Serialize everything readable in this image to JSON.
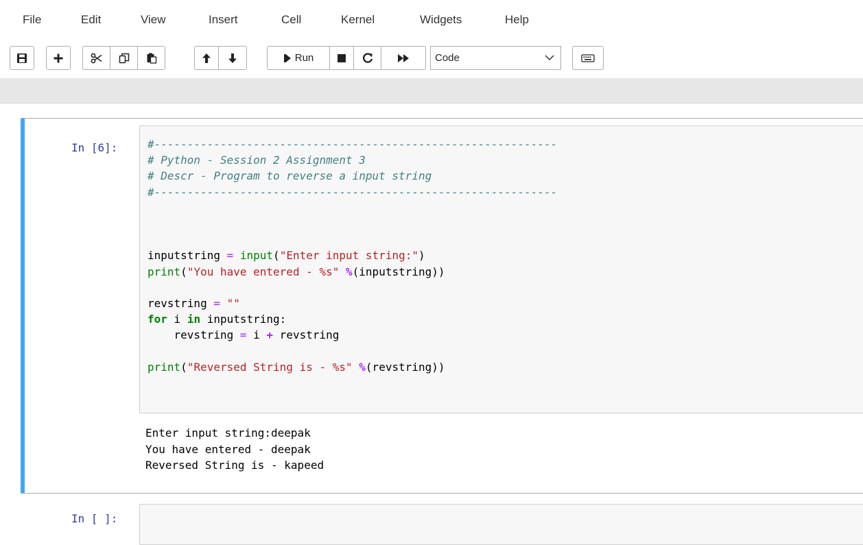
{
  "menubar": {
    "items": [
      {
        "label": "File"
      },
      {
        "label": "Edit"
      },
      {
        "label": "View"
      },
      {
        "label": "Insert"
      },
      {
        "label": "Cell"
      },
      {
        "label": "Kernel"
      },
      {
        "label": "Widgets"
      },
      {
        "label": "Help"
      }
    ]
  },
  "toolbar": {
    "buttons": [
      {
        "icon": "save-icon"
      },
      {
        "icon": "plus-icon"
      },
      {
        "icon": "scissors-icon"
      },
      {
        "icon": "copy-icon"
      },
      {
        "icon": "paste-icon"
      },
      {
        "icon": "arrow-up-icon"
      },
      {
        "icon": "arrow-down-icon"
      },
      {
        "icon": "step-forward-icon",
        "label": "Run"
      },
      {
        "icon": "stop-icon"
      },
      {
        "icon": "restart-icon"
      },
      {
        "icon": "fast-forward-icon"
      },
      {
        "icon": "keyboard-icon"
      }
    ],
    "cell_type": "Code"
  },
  "cells": [
    {
      "prompt": "In [6]:",
      "code_lines": [
        "#-------------------------------------------------------------",
        "# Python - Session 2 Assignment 3",
        "# Descr - Program to reverse a input string",
        "#-------------------------------------------------------------",
        "",
        "",
        "",
        "inputstring = input(\"Enter input string:\")",
        "print(\"You have entered - %s\" %(inputstring))",
        "",
        "revstring = \"\"",
        "for i in inputstring:",
        "    revstring = i + revstring",
        "",
        "print(\"Reversed String is - %s\" %(revstring))"
      ],
      "output_lines": [
        "Enter input string:deepak",
        "You have entered - deepak",
        "Reversed String is - kapeed"
      ]
    },
    {
      "prompt": "In [ ]:",
      "code_lines": []
    }
  ],
  "colors": {
    "selected_cell_border": "#42a5f5",
    "prompt": "#303f9f",
    "comment": "#408080",
    "builtin": "#008000",
    "string": "#ba2121",
    "operator": "#aa22ff"
  }
}
